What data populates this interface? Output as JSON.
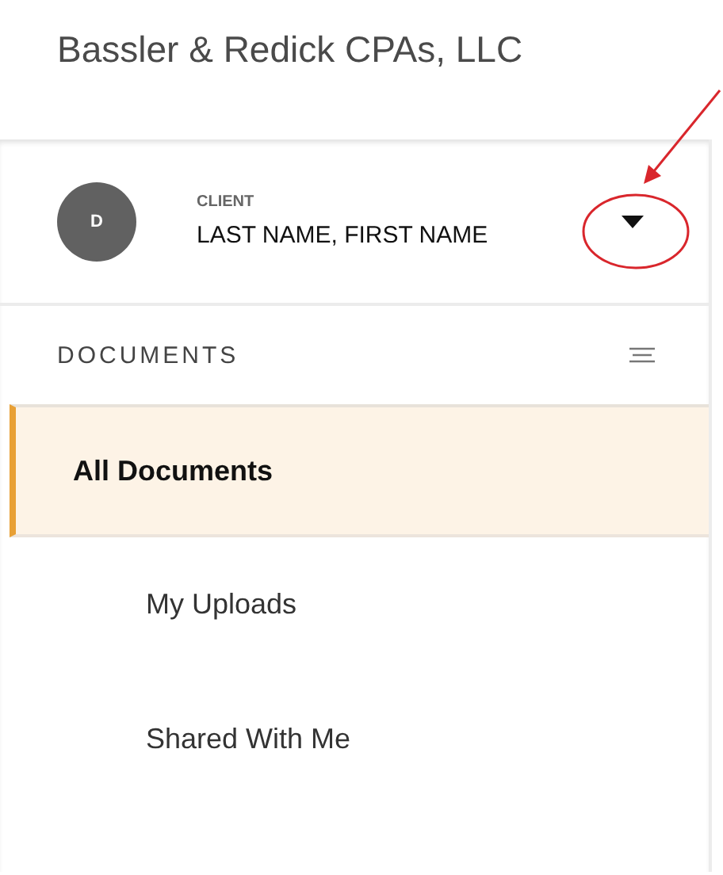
{
  "header": {
    "title": "Bassler & Redick CPAs, LLC"
  },
  "client": {
    "avatar": "D",
    "label": "CLIENT",
    "name": "LAST NAME, FIRST NAME",
    "annotated": true
  },
  "documents": {
    "heading": "DOCUMENTS",
    "items": [
      {
        "label": "All Documents",
        "selected": true,
        "kind": "top"
      },
      {
        "label": "My Uploads",
        "selected": false,
        "kind": "sub"
      },
      {
        "label": "Shared With Me",
        "selected": false,
        "kind": "sub"
      }
    ]
  }
}
